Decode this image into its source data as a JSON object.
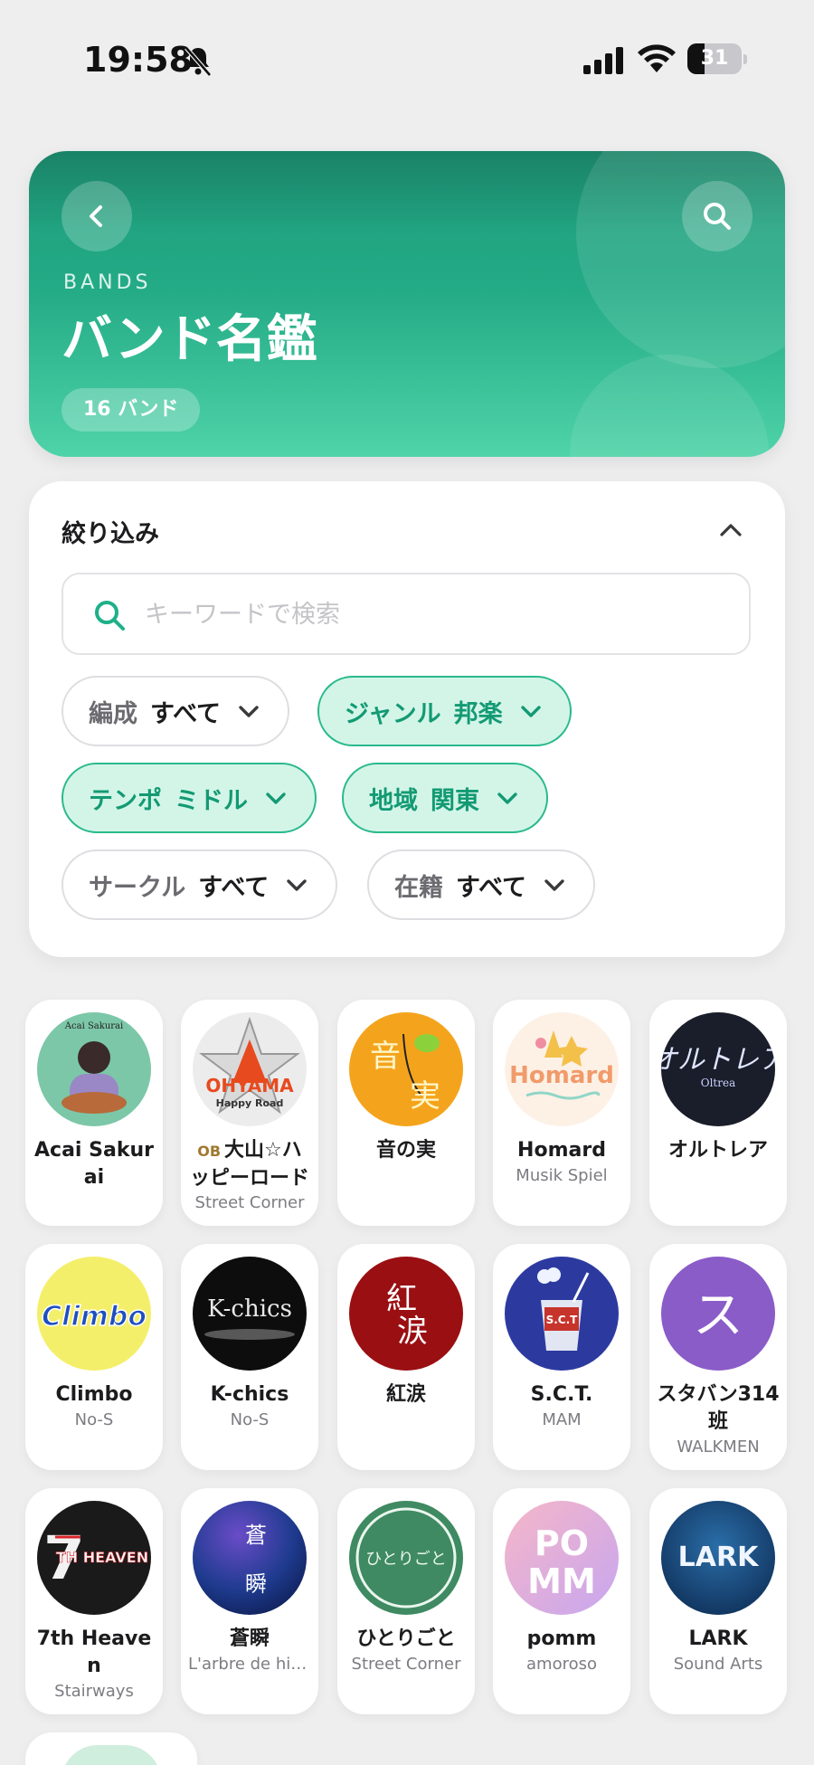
{
  "status_bar": {
    "time": "19:58",
    "battery_level": "31",
    "battery_fraction": 0.31
  },
  "hero": {
    "eyebrow": "BANDS",
    "title": "バンド名鑑",
    "count_badge": "16 バンド",
    "gradient_colors": [
      "#1f9b7a",
      "#4fd3a8"
    ]
  },
  "filter": {
    "title": "絞り込み",
    "search": {
      "placeholder": "キーワードで検索",
      "value": ""
    },
    "chips": [
      {
        "key": "編成",
        "value": "すべて",
        "active": false
      },
      {
        "key": "ジャンル",
        "value": "邦楽",
        "active": true
      },
      {
        "key": "テンポ",
        "value": "ミドル",
        "active": true
      },
      {
        "key": "地域",
        "value": "関東",
        "active": true
      },
      {
        "key": "サークル",
        "value": "すべて",
        "active": false
      },
      {
        "key": "在籍",
        "value": "すべて",
        "active": false
      }
    ],
    "accent_color": "#29b98d"
  },
  "bands": [
    {
      "name": "Acai Sakurai",
      "circle": "",
      "avatar_text": "Acai Sakurai",
      "avatar_bg": "#7cc7a8"
    },
    {
      "name": "大山☆ハッピーロード",
      "badge": "OB",
      "circle": "Street Corner",
      "avatar_text": "OHYAMA",
      "avatar_sub": "Happy Road",
      "avatar_bg": "#ececec"
    },
    {
      "name": "音の実",
      "circle": "",
      "avatar_text": "音実",
      "avatar_bg": "#f4a41c"
    },
    {
      "name": "Homard",
      "circle": "Musik Spiel",
      "avatar_text": "Homard",
      "avatar_bg": "#fdf1e6"
    },
    {
      "name": "オルトレア",
      "circle": "",
      "avatar_text": "Oltrea",
      "avatar_bg": "#1a1d2a"
    },
    {
      "name": "Climbo",
      "circle": "No-S",
      "avatar_text": "Climbo",
      "avatar_bg": "#f4ef6a"
    },
    {
      "name": "K-chics",
      "circle": "No-S",
      "avatar_text": "K-chics",
      "avatar_bg": "#0d0d0d"
    },
    {
      "name": "紅涙",
      "circle": "",
      "avatar_text": "紅涙",
      "avatar_bg": "#9a0f12"
    },
    {
      "name": "S.C.T.",
      "circle": "MAM",
      "avatar_text": "S.C.T",
      "avatar_bg": "#2c3aa0"
    },
    {
      "name": "スタバン314班",
      "circle": "WALKMEN",
      "avatar_text": "ス",
      "avatar_bg": "#8a5cc8"
    },
    {
      "name": "7th Heaven",
      "circle": "Stairways",
      "avatar_text": "7TH HEAVEN",
      "avatar_bg": "#1a1a1a"
    },
    {
      "name": "蒼瞬",
      "circle": "L'arbre de hiver",
      "avatar_text": "蒼瞬",
      "avatar_bg": "#1f3b8f"
    },
    {
      "name": "ひとりごと",
      "circle": "Street Corner",
      "avatar_text": "ひとりごと",
      "avatar_bg": "#3f8a62"
    },
    {
      "name": "pomm",
      "circle": "amoroso",
      "avatar_text": "POMM",
      "avatar_bg": "#e7a4cf"
    },
    {
      "name": "LARK",
      "circle": "Sound Arts",
      "avatar_text": "LARK",
      "avatar_bg": "#0e2d56"
    }
  ],
  "icons": {
    "bell": "bell-slash-icon",
    "back": "chevron-left-icon",
    "search": "search-icon",
    "collapse": "chevron-up-icon",
    "chip": "chevron-down-icon"
  }
}
